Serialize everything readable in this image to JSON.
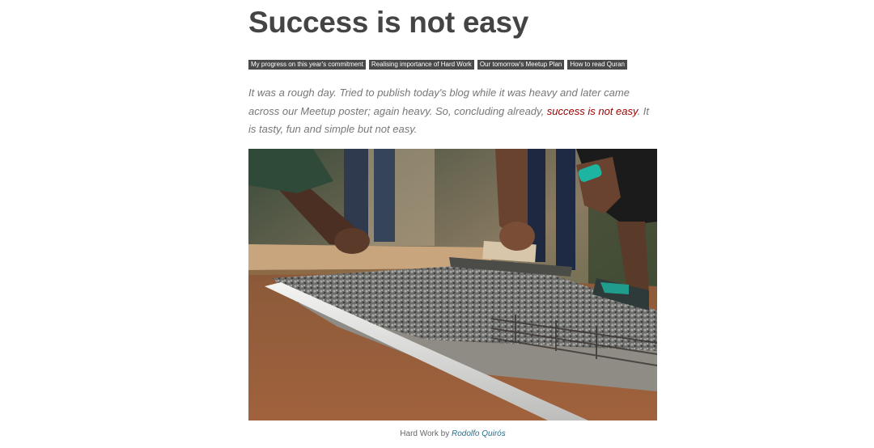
{
  "post": {
    "title": "Success is not easy",
    "tags": [
      "My progress on this year's commitment",
      "Realising importance of Hard Work",
      "Our tomorrow's Meetup Plan",
      "How to read Quran"
    ],
    "intro": {
      "before": "It was a rough day. Tried to publish today's blog while it was heavy and later came across our Meetup poster; again heavy. So, concluding already, ",
      "link": "success is not easy",
      "after": ". It is tasty, fun and simple but not easy."
    },
    "image": {
      "alt": "Hard Work",
      "caption_prefix": "Hard Work by ",
      "caption_author": "Rodolfo Quirós"
    }
  },
  "colors": {
    "text": "#444444",
    "intro_text": "#777777",
    "link": "#990000",
    "tag_background": "#4a4a4a",
    "caption_link": "#1f6f8b"
  }
}
